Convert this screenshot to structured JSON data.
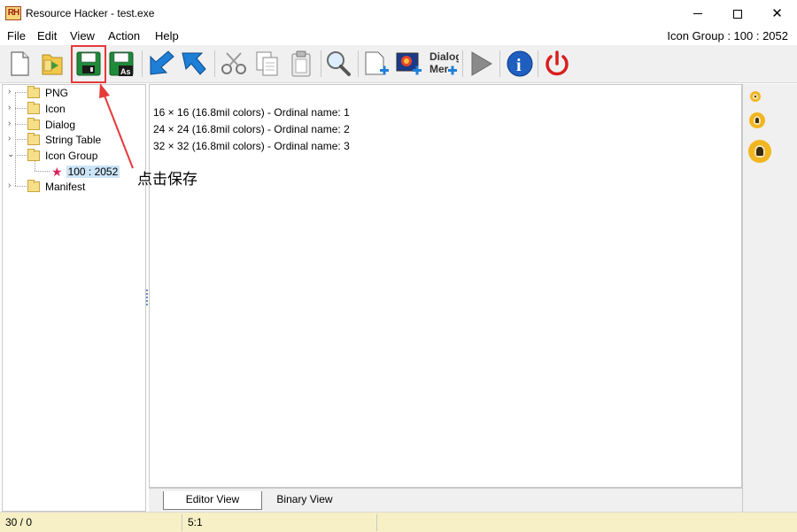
{
  "window": {
    "title": "Resource Hacker - test.exe",
    "logo_text": "RH",
    "min_icon": "minimize-icon",
    "max_icon": "maximize-icon",
    "close_icon": "close-icon",
    "close_glyph": "✕"
  },
  "menu": {
    "items": [
      "File",
      "Edit",
      "View",
      "Action",
      "Help"
    ],
    "status": "Icon Group : 100 : 2052"
  },
  "toolbar": {
    "buttons": [
      {
        "name": "new-file-icon"
      },
      {
        "name": "open-file-icon"
      },
      {
        "name": "save-icon"
      },
      {
        "name": "save-as-icon",
        "label": "As"
      },
      {
        "name": "back-arrow-icon"
      },
      {
        "name": "forward-arrow-icon"
      },
      {
        "name": "cut-icon"
      },
      {
        "name": "copy-icon"
      },
      {
        "name": "paste-icon"
      },
      {
        "name": "search-icon"
      },
      {
        "name": "add-resource-icon"
      },
      {
        "name": "add-image-icon"
      },
      {
        "name": "dialog-menu-icon",
        "label_top": "Dialog",
        "label_bottom": "Mer"
      },
      {
        "name": "compile-run-icon"
      },
      {
        "name": "info-icon",
        "label": "i"
      },
      {
        "name": "power-icon"
      }
    ]
  },
  "tree": {
    "items": [
      {
        "label": "PNG",
        "expanded": false
      },
      {
        "label": "Icon",
        "expanded": false
      },
      {
        "label": "Dialog",
        "expanded": false
      },
      {
        "label": "String Table",
        "expanded": false
      },
      {
        "label": "Icon Group",
        "expanded": true
      },
      {
        "label": "100 : 2052",
        "selected": true
      },
      {
        "label": "Manifest",
        "expanded": false
      }
    ]
  },
  "editor": {
    "lines": [
      "16 × 16 (16.8mil colors) - Ordinal name: 1",
      "24 × 24 (16.8mil colors) - Ordinal name: 2",
      "32 × 32 (16.8mil colors) - Ordinal name: 3"
    ]
  },
  "tabs": {
    "editor_view": "Editor View",
    "binary_view": "Binary View"
  },
  "status": {
    "position": "30 / 0",
    "column": "5:1"
  },
  "annotation": {
    "text": "点击保存",
    "color": "#e53a3a"
  },
  "colors": {
    "status_bar": "#f7f0c6",
    "selection": "#cce4f7",
    "highlight": "#e53a3a"
  }
}
